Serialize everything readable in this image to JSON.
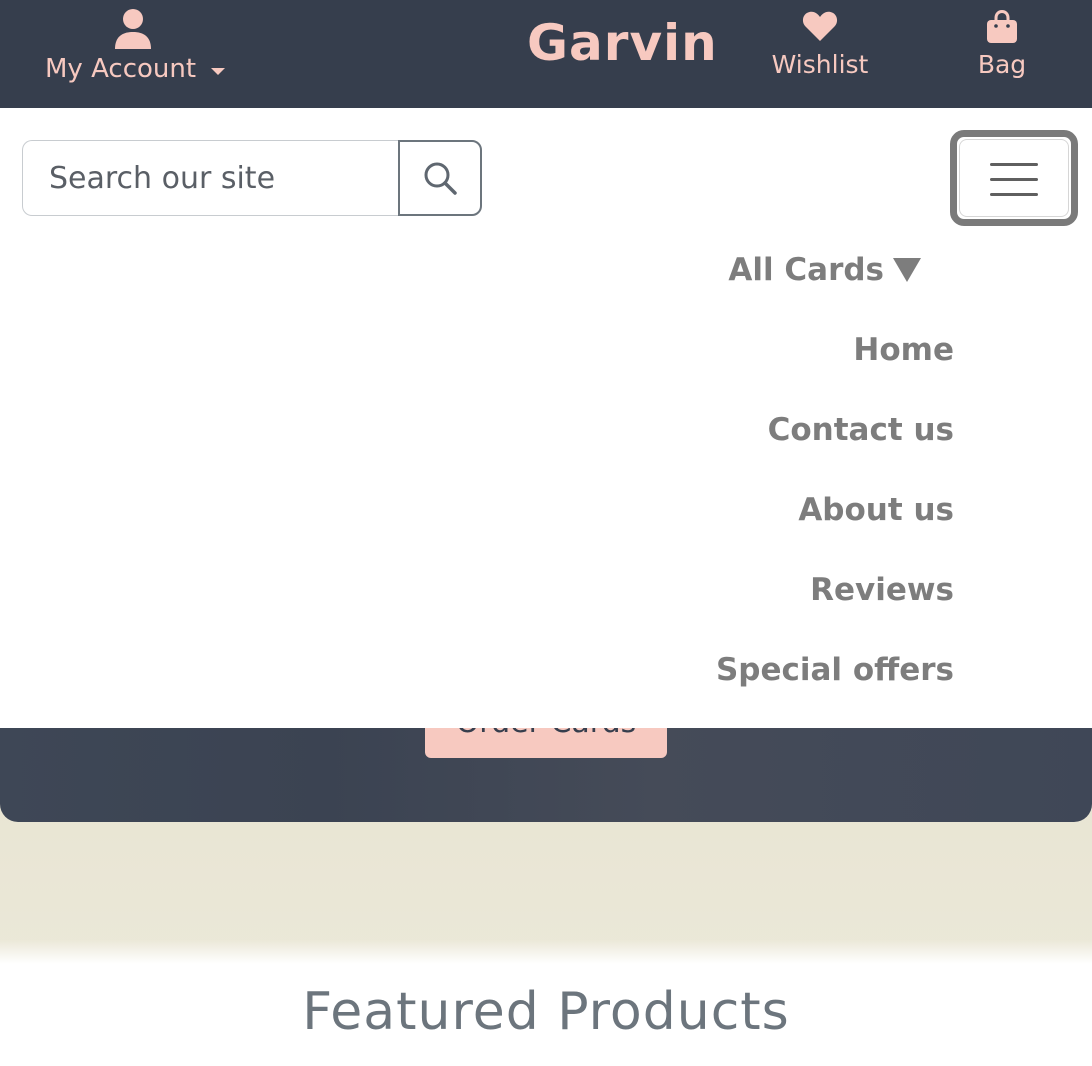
{
  "header": {
    "account_label": "My Account",
    "brand": "Garvin",
    "wishlist_label": "Wishlist",
    "bag_label": "Bag",
    "icons": {
      "account": "user-icon",
      "wishlist": "heart-icon",
      "bag": "shopping-bag-icon",
      "search": "search-icon",
      "menu": "hamburger-icon",
      "caret": "caret-down-icon"
    },
    "colors": {
      "bar_bg": "#363e4d",
      "accent": "#f7c9c0"
    }
  },
  "search": {
    "placeholder": "Search our site"
  },
  "nav": {
    "all_cards": "All Cards",
    "items": [
      "Home",
      "Contact us",
      "About us",
      "Reviews",
      "Special offers"
    ]
  },
  "hero": {
    "cta_label": "Order Cards"
  },
  "main": {
    "featured_title": "Featured Products"
  }
}
